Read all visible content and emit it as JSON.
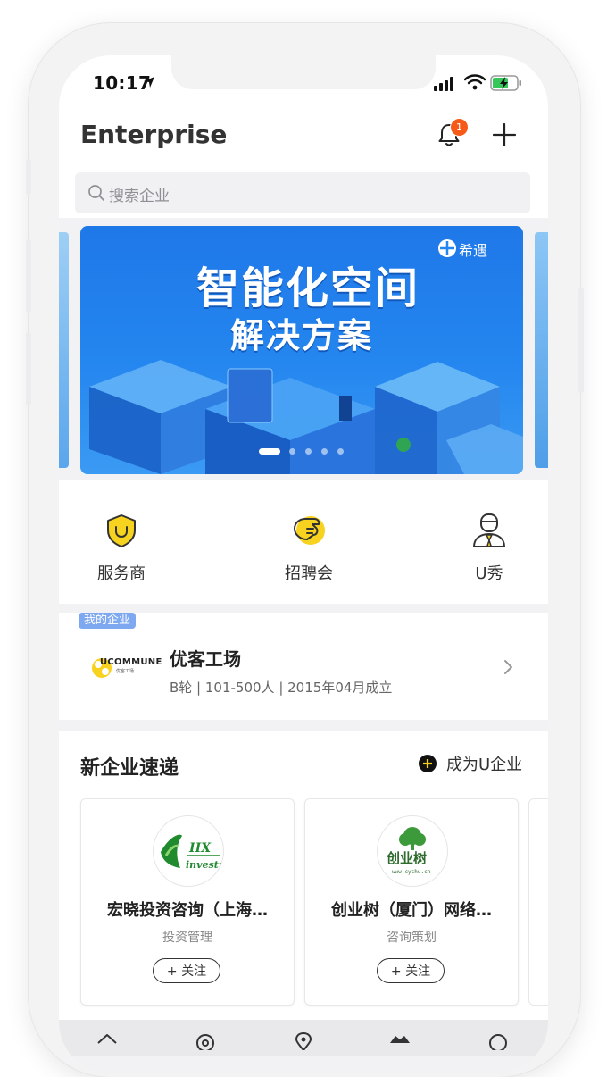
{
  "status_bar": {
    "time": "10:17"
  },
  "header": {
    "title": "Enterprise",
    "notification_count": "1"
  },
  "search": {
    "placeholder": "搜索企业"
  },
  "banner": {
    "headline": "智能化空间",
    "subline": "解决方案",
    "brand": "希遇",
    "slide_count": 5,
    "active_slide": 1
  },
  "quick_actions": [
    {
      "label": "服务商",
      "icon": "shield-icon"
    },
    {
      "label": "招聘会",
      "icon": "handshake-icon"
    },
    {
      "label": "U秀",
      "icon": "user-tie-icon"
    }
  ],
  "my_company": {
    "tag": "我的企业",
    "logo_text": "UCOMMUNE",
    "logo_subtext": "优客工场",
    "name": "优客工场",
    "meta": "B轮 | 101-500人 | 2015年04月成立"
  },
  "new_companies": {
    "title": "新企业速递",
    "join_label": "成为U企业",
    "cards": [
      {
        "logo_text": "HX",
        "logo_subtext": "investm",
        "name": "宏晓投资咨询（上海…",
        "category": "投资管理",
        "follow_label": "+ 关注"
      },
      {
        "logo_text": "创业树",
        "logo_subtext": "www.cyshu.cn",
        "name": "创业树（厦门）网络…",
        "category": "咨询策划",
        "follow_label": "+ 关注"
      }
    ]
  },
  "tabbar": {
    "icons": [
      "home-icon",
      "discover-icon",
      "location-icon",
      "enterprise-icon",
      "profile-icon"
    ]
  },
  "colors": {
    "accent_badge": "#f55a19",
    "banner_blue": "#2486ef",
    "logo_yellow": "#f7d21e",
    "tree_green": "#3c9a3a"
  }
}
